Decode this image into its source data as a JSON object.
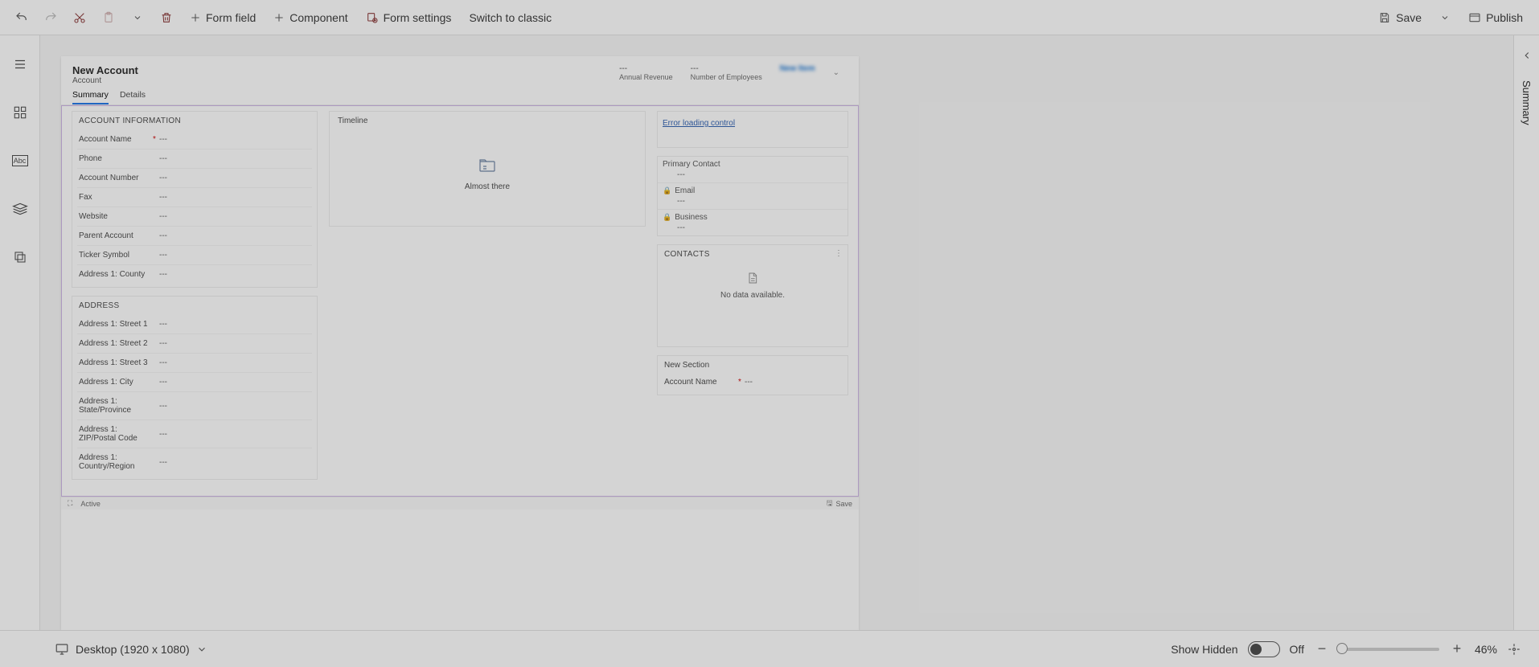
{
  "toolbar": {
    "form_field": "Form field",
    "component": "Component",
    "form_settings": "Form settings",
    "switch_classic": "Switch to classic",
    "save": "Save",
    "publish": "Publish"
  },
  "right_panel_tab": "Summary",
  "form": {
    "title": "New Account",
    "entity": "Account",
    "header_stats": [
      {
        "value": "---",
        "label": "Annual Revenue"
      },
      {
        "value": "---",
        "label": "Number of Employees"
      }
    ],
    "header_new": "New Item",
    "tabs": [
      "Summary",
      "Details"
    ],
    "active_tab": "Summary",
    "sections": {
      "account_info": {
        "title": "ACCOUNT INFORMATION",
        "fields": [
          {
            "label": "Account Name",
            "required": true,
            "value": "---"
          },
          {
            "label": "Phone",
            "required": false,
            "value": "---"
          },
          {
            "label": "Account Number",
            "required": false,
            "value": "---"
          },
          {
            "label": "Fax",
            "required": false,
            "value": "---"
          },
          {
            "label": "Website",
            "required": false,
            "value": "---"
          },
          {
            "label": "Parent Account",
            "required": false,
            "value": "---"
          },
          {
            "label": "Ticker Symbol",
            "required": false,
            "value": "---"
          },
          {
            "label": "Address 1: County",
            "required": false,
            "value": "---"
          }
        ]
      },
      "address": {
        "title": "ADDRESS",
        "fields": [
          {
            "label": "Address 1: Street 1",
            "required": false,
            "value": "---"
          },
          {
            "label": "Address 1: Street 2",
            "required": false,
            "value": "---"
          },
          {
            "label": "Address 1: Street 3",
            "required": false,
            "value": "---"
          },
          {
            "label": "Address 1: City",
            "required": false,
            "value": "---"
          },
          {
            "label": "Address 1: State/Province",
            "required": false,
            "value": "---"
          },
          {
            "label": "Address 1: ZIP/Postal Code",
            "required": false,
            "value": "---"
          },
          {
            "label": "Address 1: Country/Region",
            "required": false,
            "value": "---"
          }
        ]
      },
      "timeline": {
        "title": "Timeline",
        "message": "Almost there"
      },
      "error_link": "Error loading control",
      "primary_contact": {
        "title": "Primary Contact",
        "value": "---",
        "email_label": "Email",
        "email_value": "---",
        "business_label": "Business",
        "business_value": "---"
      },
      "contacts": {
        "title": "CONTACTS",
        "empty": "No data available."
      },
      "new_section": {
        "title": "New Section",
        "field_label": "Account Name",
        "field_value": "---"
      }
    },
    "footer": {
      "status": "Active",
      "save": "Save"
    }
  },
  "statusbar": {
    "device": "Desktop (1920 x 1080)",
    "show_hidden_label": "Show Hidden",
    "show_hidden_state": "Off",
    "zoom": "46%"
  }
}
